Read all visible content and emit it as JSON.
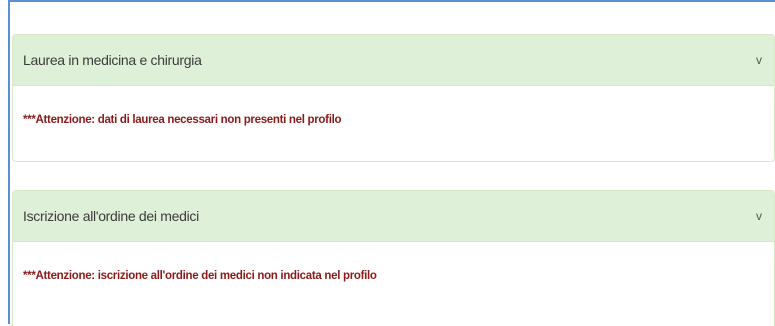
{
  "panels": [
    {
      "title": "Laurea in medicina e chirurgia",
      "chevron": "v",
      "warning": "***Attenzione: dati di laurea necessari non presenti nel profilo"
    },
    {
      "title": "Iscrizione all'ordine dei medici",
      "chevron": "v",
      "warning": "***Attenzione: iscrizione all'ordine dei medici non indicata nel profilo"
    }
  ],
  "colors": {
    "heading_bg": "#dff0d8",
    "heading_border": "#d6e9c6",
    "warning_text": "#8b1a1a",
    "frame_border": "#5a8fd6"
  }
}
